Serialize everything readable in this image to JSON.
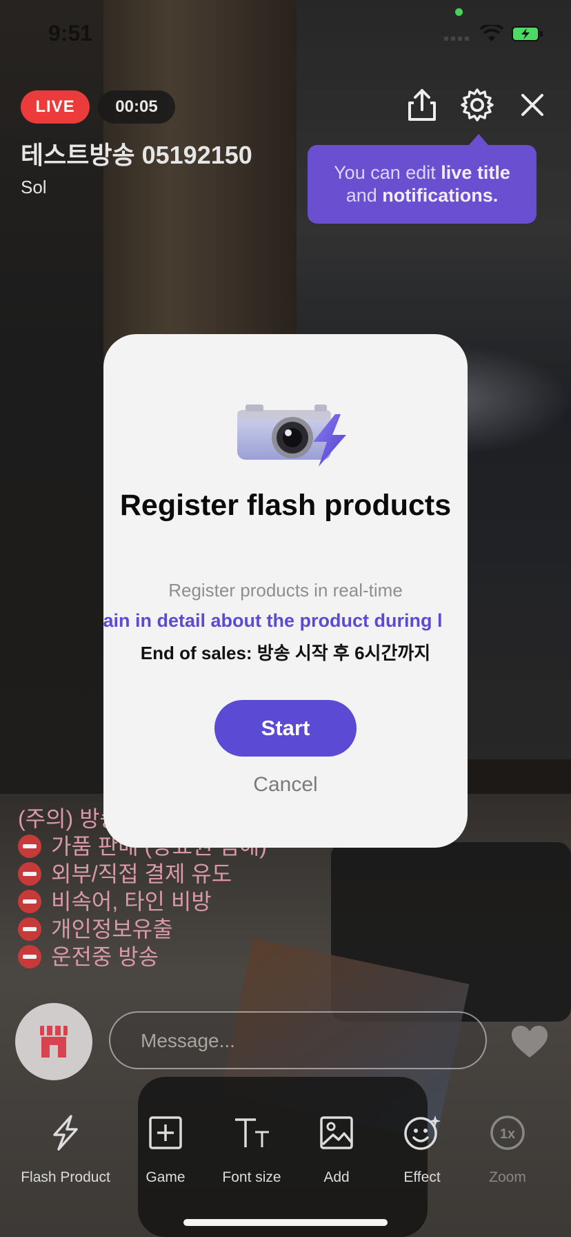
{
  "status_bar": {
    "time": "9:51"
  },
  "header": {
    "live_badge": "LIVE",
    "timer": "00:05",
    "title": "테스트방송 05192150",
    "host": "Sol"
  },
  "tooltip": {
    "part1": "You can edit ",
    "bold1": "live title",
    "part2": "and ",
    "bold2": "notifications."
  },
  "modal": {
    "title": "Register flash products",
    "line1": "Register products in real-time",
    "line2": "lain in detail about the product during l",
    "line3": "End of sales: 방송 시작 후 6시간까지",
    "start_label": "Start",
    "cancel_label": "Cancel"
  },
  "notice": {
    "heading": "(주의) 방송 운영정책 위반 시, 즉시 페널티",
    "items": [
      "가품 판매 (상표권 침해)",
      "외부/직접 결제 유도",
      "비속어, 타인 비방",
      "개인정보유출",
      "운전중 방송"
    ]
  },
  "chat": {
    "placeholder": "Message..."
  },
  "toolbar": {
    "flash": "Flash Product",
    "game": "Game",
    "font_size": "Font size",
    "add": "Add",
    "effect": "Effect",
    "zoom": "Zoom"
  },
  "colors": {
    "accent": "#5b4bd4",
    "live": "#ec3b3b",
    "tooltip": "#6a4fd0"
  },
  "icons": [
    "share-icon",
    "gear-icon",
    "close-icon",
    "camera-flash-icon",
    "shop-icon",
    "heart-icon",
    "flash-icon",
    "plus-square-icon",
    "font-size-icon",
    "image-icon",
    "smile-icon",
    "zoom-icon"
  ]
}
